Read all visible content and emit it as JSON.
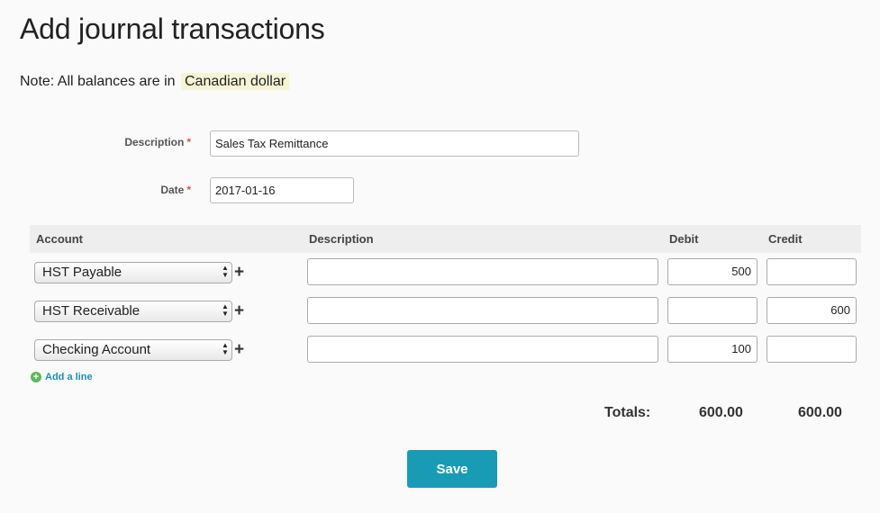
{
  "page": {
    "title": "Add journal transactions",
    "note_prefix": "Note: All balances are in",
    "currency": "Canadian dollar"
  },
  "form": {
    "description_label": "Description",
    "description_value": "Sales Tax Remittance",
    "date_label": "Date",
    "date_value": "2017-01-16",
    "required_marker": "*"
  },
  "table": {
    "headers": {
      "account": "Account",
      "description": "Description",
      "debit": "Debit",
      "credit": "Credit"
    },
    "rows": [
      {
        "account": "HST Payable",
        "description": "",
        "debit": "500",
        "credit": ""
      },
      {
        "account": "HST Receivable",
        "description": "",
        "debit": "",
        "credit": "600"
      },
      {
        "account": "Checking Account",
        "description": "",
        "debit": "100",
        "credit": ""
      }
    ],
    "add_account_symbol": "+",
    "add_line_label": "Add a line"
  },
  "totals": {
    "label": "Totals:",
    "debit": "600.00",
    "credit": "600.00"
  },
  "actions": {
    "save_label": "Save"
  },
  "colors": {
    "save_button": "#1a9bb5",
    "add_line_link": "#1a8fb8",
    "add_line_icon": "#5cb85c",
    "required": "#d9534f",
    "currency_highlight": "#f5f5d5"
  }
}
